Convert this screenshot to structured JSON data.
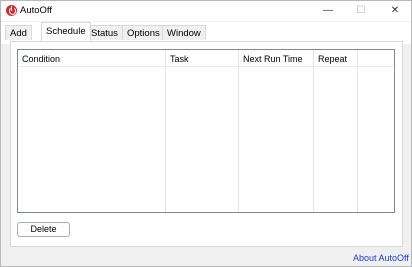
{
  "window": {
    "title": "AutoOff",
    "controls": {
      "minimize": "—",
      "maximize": "☐",
      "close": "✕"
    }
  },
  "tabs": [
    {
      "label": "Add"
    },
    {
      "label": "Schedule"
    },
    {
      "label": "Status"
    },
    {
      "label": "Options"
    },
    {
      "label": "Window"
    }
  ],
  "active_tab": "Schedule",
  "schedule": {
    "columns": [
      "Condition",
      "Task",
      "Next Run Time",
      "Repeat"
    ],
    "rows": [],
    "delete_label": "Delete"
  },
  "footer": {
    "about_label": "About AutoOff"
  },
  "colors": {
    "app_icon": "#d42a2a",
    "link": "#1a3cd6"
  }
}
